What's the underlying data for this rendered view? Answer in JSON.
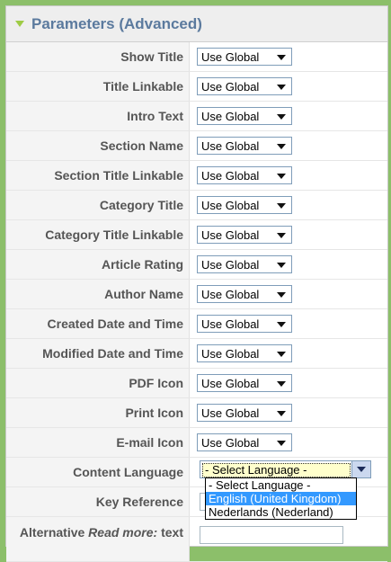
{
  "panel": {
    "title": "Parameters (Advanced)"
  },
  "params": [
    {
      "label": "Show Title",
      "value": "Use Global"
    },
    {
      "label": "Title Linkable",
      "value": "Use Global"
    },
    {
      "label": "Intro Text",
      "value": "Use Global"
    },
    {
      "label": "Section Name",
      "value": "Use Global"
    },
    {
      "label": "Section Title Linkable",
      "value": "Use Global"
    },
    {
      "label": "Category Title",
      "value": "Use Global"
    },
    {
      "label": "Category Title Linkable",
      "value": "Use Global"
    },
    {
      "label": "Article Rating",
      "value": "Use Global"
    },
    {
      "label": "Author Name",
      "value": "Use Global"
    },
    {
      "label": "Created Date and Time",
      "value": "Use Global"
    },
    {
      "label": "Modified Date and Time",
      "value": "Use Global"
    },
    {
      "label": "PDF Icon",
      "value": "Use Global"
    },
    {
      "label": "Print Icon",
      "value": "Use Global"
    },
    {
      "label": "E-mail Icon",
      "value": "Use Global"
    }
  ],
  "content_language": {
    "label": "Content Language",
    "value": "- Select Language -",
    "options": [
      "- Select Language -",
      "English (United Kingdom)",
      "Nederlands (Nederland)"
    ],
    "highlighted_option": "English (United Kingdom)"
  },
  "key_reference": {
    "label": "Key Reference"
  },
  "alternative_read_more": {
    "label_prefix": "Alternative ",
    "label_emphasis": "Read more:",
    "label_suffix": " text"
  }
}
